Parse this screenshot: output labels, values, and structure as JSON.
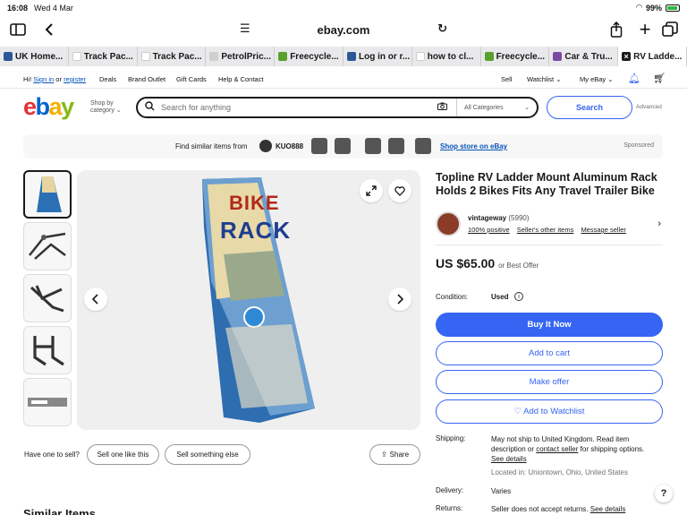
{
  "status_bar": {
    "time": "16:08",
    "date": "Wed 4 Mar",
    "battery": "99%"
  },
  "browser": {
    "url": "ebay.com",
    "tabs": [
      {
        "label": "UK Home...",
        "icon": "ebay-favicon",
        "color": "#2b5797"
      },
      {
        "label": "Track Pac...",
        "icon": "amazon-favicon",
        "color": "#ffffff"
      },
      {
        "label": "Track Pac...",
        "icon": "amazon-favicon",
        "color": "#ffffff"
      },
      {
        "label": "PetrolPric...",
        "icon": "petrol-favicon",
        "color": "#cfcfcf"
      },
      {
        "label": "Freecycle...",
        "icon": "freecycle-favicon",
        "color": "#5aa02c"
      },
      {
        "label": "Log in or r...",
        "icon": "login-favicon",
        "color": "#2b5797"
      },
      {
        "label": "how to cl...",
        "icon": "google-favicon",
        "color": "#ffffff"
      },
      {
        "label": "Freecycle...",
        "icon": "freecycle-favicon",
        "color": "#5aa02c"
      },
      {
        "label": "Car & Tru...",
        "icon": "car-favicon",
        "color": "#7a4aa0"
      },
      {
        "label": "RV Ladde...",
        "icon": "close-icon",
        "color": "#191919"
      }
    ]
  },
  "topnav": {
    "greeting": "Hi!",
    "sign_in": "Sign in",
    "or": "or",
    "register": "register",
    "deals": "Deals",
    "brand_outlet": "Brand Outlet",
    "gift_cards": "Gift Cards",
    "help": "Help & Contact",
    "sell": "Sell",
    "watchlist": "Watchlist",
    "my_ebay": "My eBay"
  },
  "header": {
    "logo_letters": [
      "e",
      "b",
      "a",
      "y"
    ],
    "logo_colors": [
      "#e53238",
      "#0064d2",
      "#f5af02",
      "#86b817"
    ],
    "shop_by_line1": "Shop by",
    "shop_by_line2": "category",
    "search_placeholder": "Search for anything",
    "all_categories": "All Categories",
    "search_button": "Search",
    "advanced": "Advanced"
  },
  "sponsored": {
    "find_similar": "Find similar items from",
    "seller": "KUO888",
    "shop_store": "Shop store on eBay",
    "label": "Sponsored"
  },
  "product": {
    "title": "Topline RV Ladder Mount Aluminum Rack Holds 2 Bikes Fits Any Travel Trailer Bike",
    "box_text_1": "BIKE",
    "box_text_2": "RACK",
    "seller_name": "vintageway",
    "seller_count": "(5990)",
    "positive": "100% positive",
    "other_items": "Seller's other items",
    "message": "Message seller",
    "price": "US $65.00",
    "best_offer": "or Best Offer",
    "condition_label": "Condition:",
    "condition_value": "Used",
    "buy_now": "Buy It Now",
    "add_cart": "Add to cart",
    "make_offer": "Make offer",
    "watchlist": "Add to Watchlist",
    "have_one": "Have one to sell?",
    "sell_like": "Sell one like this",
    "sell_else": "Sell something else",
    "share": "Share"
  },
  "shipping": {
    "label": "Shipping:",
    "line1": "May not ship to United Kingdom. Read item description or",
    "contact": "contact seller",
    "line2": "for shipping options.",
    "see_details": "See details",
    "location": "Located in: Uniontown, Ohio, United States",
    "delivery_label": "Delivery:",
    "delivery_value": "Varies",
    "returns_label": "Returns:",
    "returns_value": "Seller does not accept returns.",
    "returns_link": "See details"
  },
  "similar_heading": "Similar Items"
}
